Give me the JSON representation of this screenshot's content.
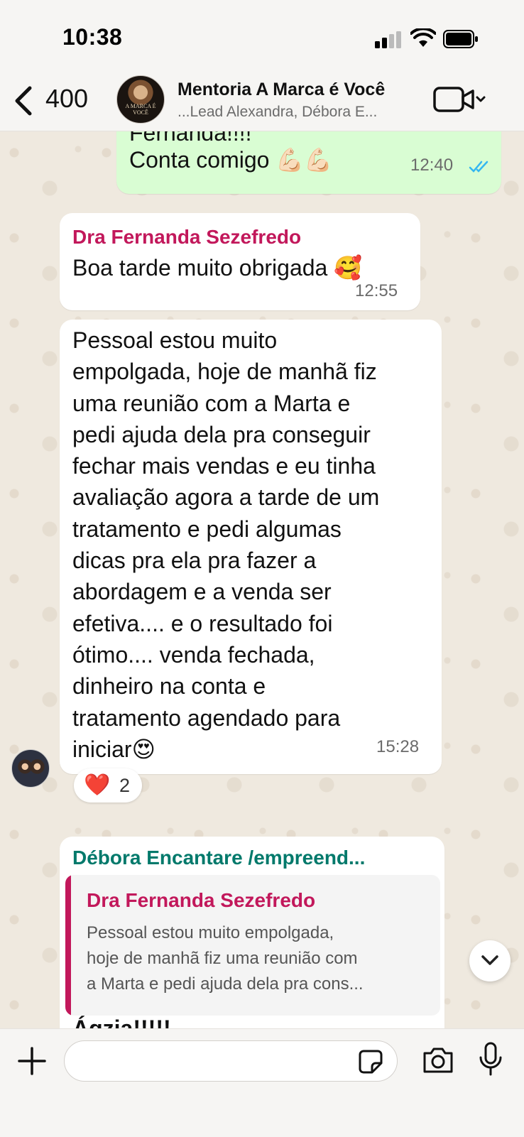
{
  "status_bar": {
    "time": "10:38"
  },
  "header": {
    "back_count": "400",
    "title": "Mentoria A Marca é Você",
    "subtitle": "...Lead Alexandra, Débora  E...",
    "avatar_text": "A MARCA É VOCÊ"
  },
  "messages": [
    {
      "direction": "outgoing",
      "lines": [
        "Fernanda!!!!",
        "Conta comigo 💪🏻💪🏻"
      ],
      "time": "12:40",
      "status": "read"
    },
    {
      "direction": "incoming",
      "sender": "Dra Fernanda Sezefredo",
      "text": "Boa tarde muito obrigada 🥰",
      "time": "12:55"
    },
    {
      "direction": "incoming",
      "lines": [
        "Pessoal estou muito",
        "empolgada, hoje de manhã fiz",
        "uma reunião com a Marta e",
        "pedi ajuda dela pra conseguir",
        "fechar mais vendas e eu tinha",
        "avaliação agora a tarde de um",
        "tratamento e pedi algumas",
        "dicas pra ela pra fazer a",
        "abordagem e a venda ser",
        "efetiva.... e o resultado foi",
        "ótimo.... venda fechada,",
        "dinheiro na conta e",
        "tratamento agendado para",
        "iniciar😍"
      ],
      "time": "15:28",
      "reaction": {
        "emoji": "❤️",
        "count": "2"
      }
    },
    {
      "direction": "incoming",
      "sender": "Débora  Encantare /empreend...",
      "quote": {
        "sender": "Dra Fernanda Sezefredo",
        "lines": [
          "Pessoal estou muito empolgada,",
          "hoje de manhã fiz uma reunião com",
          "a Marta e pedi ajuda dela pra cons..."
        ]
      },
      "partial_text": "Ágzia!!!!!"
    }
  ],
  "input": {
    "placeholder": ""
  },
  "icons": {
    "back": "chevron-left-icon",
    "video": "video-camera-icon",
    "plus": "plus-icon",
    "sticker": "sticker-icon",
    "camera": "camera-icon",
    "mic": "microphone-icon",
    "scroll": "chevron-down-icon"
  },
  "colors": {
    "outgoing_bubble": "#d9fdd3",
    "incoming_bubble": "#ffffff",
    "sender_pink": "#c2185b",
    "sender_teal": "#00796b",
    "read_ticks": "#34b7f1"
  }
}
